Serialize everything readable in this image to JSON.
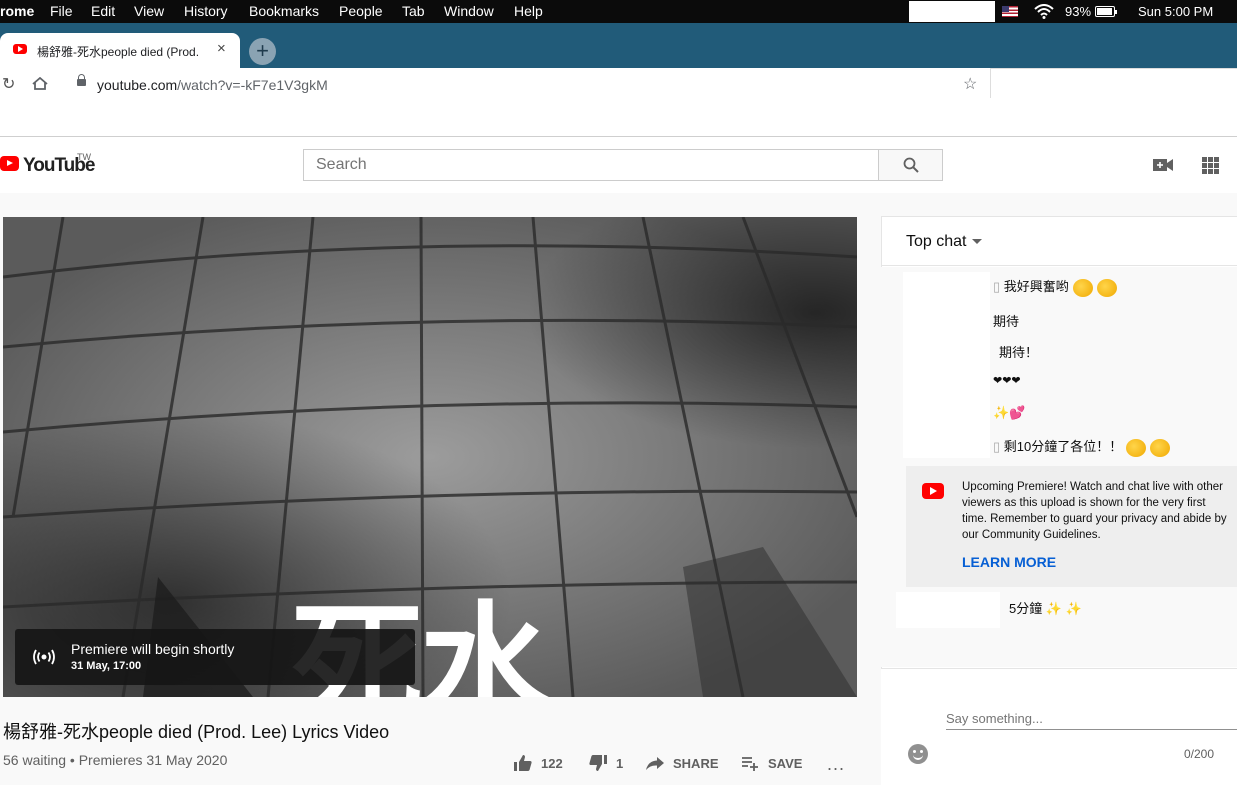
{
  "menubar": {
    "app_name": "rome",
    "items": [
      "File",
      "Edit",
      "View",
      "History",
      "Bookmarks",
      "People",
      "Tab",
      "Window",
      "Help"
    ],
    "battery": "93%",
    "battery_level": 0.93,
    "clock": "Sun 5:00 PM"
  },
  "browser": {
    "tab_title": "楊舒雅-死水people died (Prod.",
    "tab_close": "×",
    "new_tab": "+",
    "url_host": "youtube.com",
    "url_path": "/watch?v=-kF7e1V3gkM"
  },
  "youtube": {
    "logo_text": "YouTube",
    "region": "TW",
    "search_placeholder": "Search"
  },
  "video": {
    "overlay_text": "死水",
    "premiere_title": "Premiere will begin shortly",
    "premiere_date": "31 May, 17:00",
    "title": "楊舒雅-死水people died (Prod. Lee) Lyrics Video",
    "meta": "56 waiting • Premieres 31 May 2020",
    "likes": "122",
    "dislikes": "1",
    "share": "SHARE",
    "save": "SAVE",
    "more": "..."
  },
  "chat": {
    "header": "Top chat",
    "messages": [
      {
        "prefix": "▯",
        "text": "我好興奮哟"
      },
      {
        "text": "期待"
      },
      {
        "text": "期待！"
      },
      {
        "text": "❤❤❤"
      },
      {
        "text": "✨💕"
      },
      {
        "prefix": "▯",
        "text": "剩10分鐘了各位！！"
      },
      {
        "text": "5分鐘 ✨ ✨"
      }
    ],
    "notice_text": "Upcoming Premiere! Watch and chat live with other viewers as this upload is shown for the very first time. Remember to guard your privacy and abide by our Community Guidelines.",
    "learn_more": "LEARN MORE",
    "input_placeholder": "Say something...",
    "counter": "0/200"
  }
}
